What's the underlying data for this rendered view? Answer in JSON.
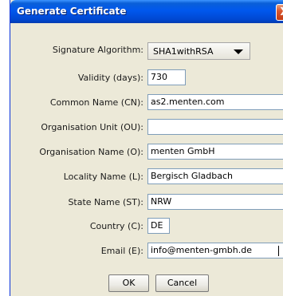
{
  "window": {
    "title": "Generate Certificate",
    "close_label": "X"
  },
  "form": {
    "signature_algorithm": {
      "label": "Signature Algorithm:",
      "value": "SHA1withRSA"
    },
    "validity": {
      "label": "Validity (days):",
      "value": "730"
    },
    "common_name": {
      "label": "Common Name (CN):",
      "value": "as2.menten.com"
    },
    "org_unit": {
      "label": "Organisation Unit (OU):",
      "value": ""
    },
    "org_name": {
      "label": "Organisation Name (O):",
      "value": "menten GmbH"
    },
    "locality": {
      "label": "Locality Name (L):",
      "value": "Bergisch Gladbach"
    },
    "state": {
      "label": "State Name (ST):",
      "value": "NRW"
    },
    "country": {
      "label": "Country (C):",
      "value": "DE"
    },
    "email": {
      "label": "Email (E):",
      "value": "info@menten-gmbh.de"
    }
  },
  "buttons": {
    "ok_label": "OK",
    "cancel_label": "Cancel"
  }
}
